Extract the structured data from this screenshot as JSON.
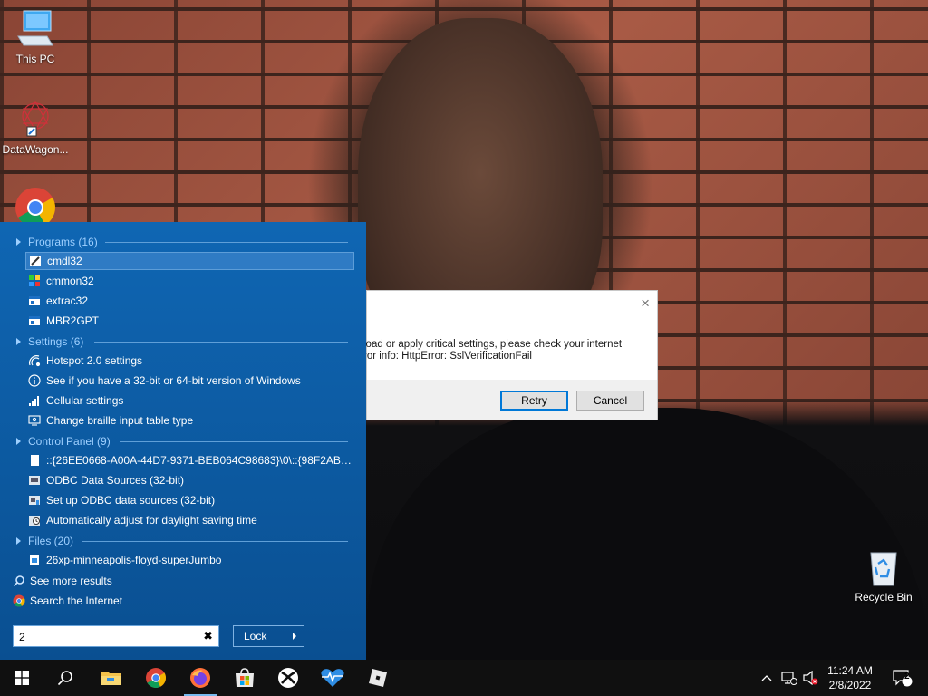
{
  "desktop": {
    "icons": [
      {
        "label": "This PC"
      },
      {
        "label": "DataWagon..."
      },
      {
        "label": "Recycle Bin"
      }
    ]
  },
  "search": {
    "sections": {
      "programs": {
        "label": "Programs (16)",
        "items": [
          "cmdl32",
          "cmmon32",
          "extrac32",
          "MBR2GPT"
        ]
      },
      "settings": {
        "label": "Settings (6)",
        "items": [
          "Hotspot 2.0 settings",
          "See if you have a 32-bit or 64-bit version of Windows",
          "Cellular settings",
          "Change braille input table type"
        ]
      },
      "control_panel": {
        "label": "Control Panel (9)",
        "items": [
          "::{26EE0668-A00A-44D7-9371-BEB064C98683}\\0\\::{98F2AB62-0E...",
          "ODBC Data Sources (32-bit)",
          "Set up ODBC data sources (32-bit)",
          "Automatically adjust for daylight saving time"
        ]
      },
      "files": {
        "label": "Files (20)",
        "items": [
          "26xp-minneapolis-floyd-superJumbo"
        ]
      }
    },
    "see_more": "See more results",
    "search_internet": "Search the Internet",
    "query": "2",
    "clear_symbol": "✖",
    "lock_label": "Lock"
  },
  "dialog": {
    "message_line1": "load or apply critical settings, please check your internet",
    "message_line2": "ror info: HttpError: SslVerificationFail",
    "retry_label": "Retry",
    "cancel_label": "Cancel",
    "close_symbol": "×"
  },
  "taskbar": {
    "time": "11:24 AM",
    "date": "2/8/2022",
    "notification_count": "2"
  },
  "colors": {
    "panel": "#0c5aa0",
    "section_heading": "#9fd0ff",
    "taskbar": "#101010",
    "accent": "#0078d7"
  }
}
